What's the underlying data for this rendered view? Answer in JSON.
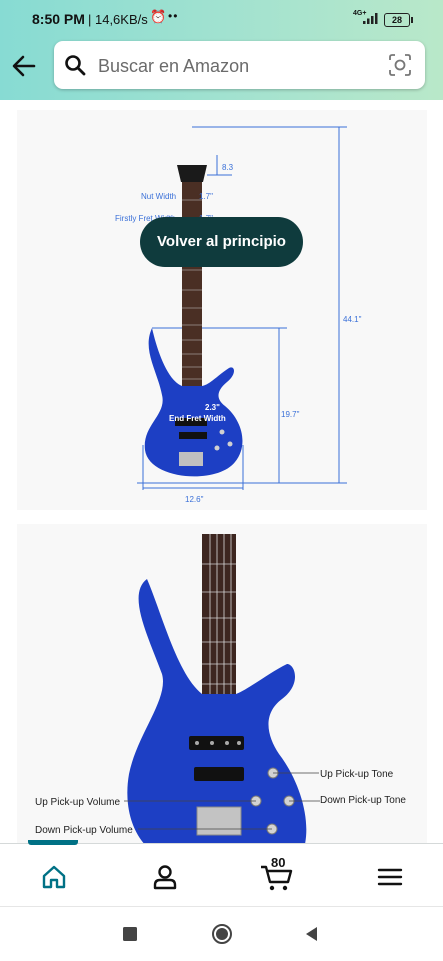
{
  "status_bar": {
    "time": "8:50 PM",
    "net_speed": "| 14,6KB/s",
    "alarm_icon": "alarm-icon",
    "dots": "••",
    "network_type": "4G+",
    "battery": "28"
  },
  "search": {
    "placeholder": "Buscar en Amazon",
    "icon": "search-icon",
    "camera_icon": "camera-scan-icon"
  },
  "back_to_top": "Volver al principio",
  "image1": {
    "labels": {
      "top_small": "8.3",
      "nut_width_label": "Nut Width",
      "nut_width_value": "1.7\"",
      "first_fret_label": "Firstly Fret Width",
      "first_fret_value": "1.7\"",
      "total_length": "44.1\"",
      "end_fret_value": "2.3\"",
      "end_fret_label": "End Fret Width",
      "body_length": "19.7\"",
      "body_width": "12.6\""
    },
    "guitar_color": "#1d3fc4"
  },
  "image2": {
    "labels": {
      "up_tone": "Up Pick-up Tone",
      "up_volume": "Up Pick-up Volume",
      "down_tone": "Down Pick-up Tone",
      "down_volume": "Down Pick-up Volume"
    }
  },
  "bottom_nav": {
    "items": [
      "home-icon",
      "account-icon",
      "cart-icon",
      "menu-icon"
    ],
    "cart_count": "80",
    "accent": "#007185"
  },
  "system_nav": [
    "recent-apps-icon",
    "home-circle-icon",
    "back-triangle-icon"
  ]
}
